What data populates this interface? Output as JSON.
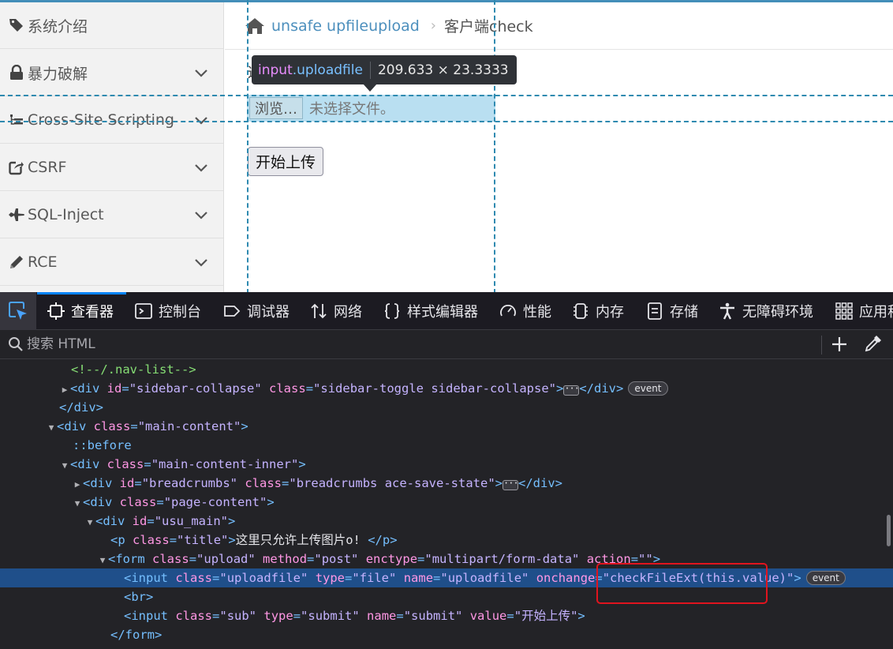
{
  "sidebar": {
    "items": [
      {
        "label": "系统介绍",
        "icon": "tag-icon",
        "has_chevron": false
      },
      {
        "label": "暴力破解",
        "icon": "lock-icon",
        "has_chevron": true
      },
      {
        "label": "Cross-Site Scripting",
        "icon": "tree-icon",
        "has_chevron": true
      },
      {
        "label": "CSRF",
        "icon": "share-icon",
        "has_chevron": true
      },
      {
        "label": "SQL-Inject",
        "icon": "plane-icon",
        "has_chevron": true
      },
      {
        "label": "RCE",
        "icon": "pencil-icon",
        "has_chevron": true
      }
    ]
  },
  "breadcrumb": {
    "link": "unsafe upfileupload",
    "current": "客户端check"
  },
  "page": {
    "title_peek": "这",
    "browse_label": "浏览…",
    "no_file_label": "未选择文件。",
    "submit_label": "开始上传"
  },
  "tooltip": {
    "tag": "input",
    "class": ".uploadfile",
    "dims": "209.633 × 23.3333"
  },
  "devtools": {
    "tabs": [
      {
        "label": "查看器",
        "icon": "inspector-icon"
      },
      {
        "label": "控制台",
        "icon": "console-icon"
      },
      {
        "label": "调试器",
        "icon": "debugger-icon"
      },
      {
        "label": "网络",
        "icon": "network-icon"
      },
      {
        "label": "样式编辑器",
        "icon": "style-editor-icon"
      },
      {
        "label": "性能",
        "icon": "performance-icon"
      },
      {
        "label": "内存",
        "icon": "memory-icon"
      },
      {
        "label": "存储",
        "icon": "storage-icon"
      },
      {
        "label": "无障碍环境",
        "icon": "accessibility-icon"
      },
      {
        "label": "应用程",
        "icon": "application-icon"
      }
    ],
    "search_placeholder": "搜索 HTML",
    "event_badge": "event",
    "dots": "···"
  },
  "accent_colors": {
    "page_top_bar": "#438eb9",
    "guide_lines": "#2f8ab0",
    "selected_row": "#1f4f8a",
    "annotation_box": "#e0141e"
  }
}
